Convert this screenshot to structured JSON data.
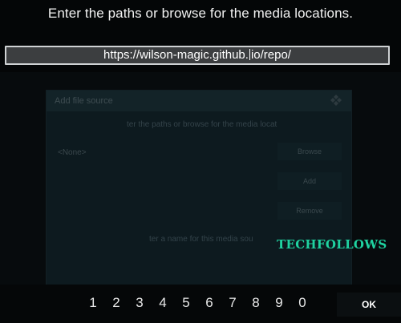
{
  "prompt": "Enter the paths or browse for the media locations.",
  "url_field": {
    "value": "https://wilson-magic.github.io/repo/"
  },
  "background_dialog": {
    "title": "Add file source",
    "subtitle": "ter the paths or browse for the media locat",
    "source_value": "<None>",
    "browse_label": "Browse",
    "add_label": "Add",
    "remove_label": "Remove",
    "name_prompt": "ter a name for this media sou"
  },
  "watermark": "TECHFOLLOWS",
  "keypad": {
    "digits": [
      "1",
      "2",
      "3",
      "4",
      "5",
      "6",
      "7",
      "8",
      "9",
      "0"
    ],
    "ok_label": "OK"
  },
  "colors": {
    "accent": "#1fd2a0",
    "field_border": "#cfd2d4",
    "field_bg": "#3c3e40"
  }
}
